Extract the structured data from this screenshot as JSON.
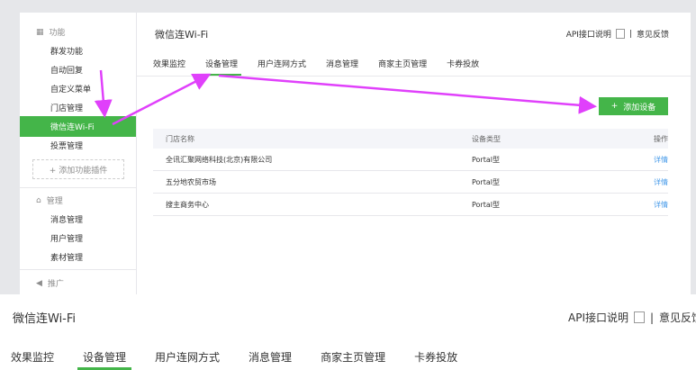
{
  "sidebar": {
    "func_header": "功能",
    "items": [
      "群发功能",
      "自动回复",
      "自定义菜单",
      "门店管理"
    ],
    "active": "微信连Wi-Fi",
    "after": "投票管理",
    "add_plugin": "+ 添加功能插件",
    "manage_header": "管理",
    "manage_items": [
      "消息管理",
      "用户管理",
      "素材管理"
    ],
    "promo_header": "推广"
  },
  "main": {
    "title": "微信连Wi-Fi",
    "api_link": "API接口说明",
    "sep": "|",
    "feedback": "意见反馈",
    "tabs": [
      "效果监控",
      "设备管理",
      "用户连网方式",
      "消息管理",
      "商家主页管理",
      "卡券投放"
    ],
    "add_device": "添加设备",
    "table": {
      "headers": [
        "门店名称",
        "设备类型",
        "操作"
      ],
      "rows": [
        [
          "全讯汇聚网络科技(北京)有限公司",
          "Portal型",
          "详情"
        ],
        [
          "五分地农贸市场",
          "Portal型",
          "详情"
        ],
        [
          "搜主商务中心",
          "Portal型",
          "详情"
        ]
      ]
    }
  },
  "bottom": {
    "title": "微信连Wi-Fi",
    "api_link": "API接口说明",
    "sep": "|",
    "feedback": "意见反馈",
    "tabs": [
      "效果监控",
      "设备管理",
      "用户连网方式",
      "消息管理",
      "商家主页管理",
      "卡券投放"
    ]
  },
  "colors": {
    "accent": "#44b549",
    "arrow": "#e040fb",
    "link": "#459ae9"
  }
}
